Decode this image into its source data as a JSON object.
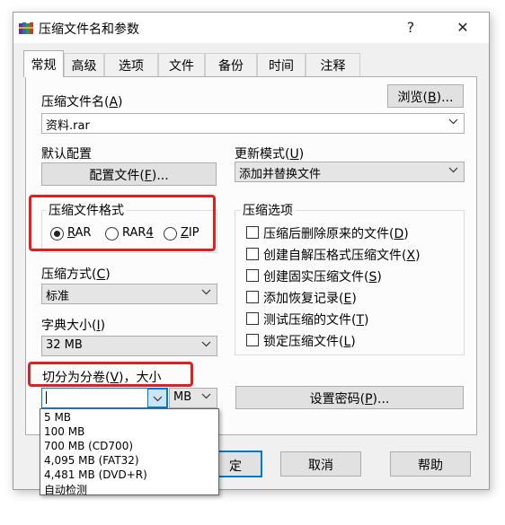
{
  "window": {
    "title": "压缩文件名和参数",
    "help_glyph": "?",
    "close_glyph": "✕",
    "icon": "winrar-books-icon"
  },
  "tabs": [
    {
      "label": "常规",
      "active": true
    },
    {
      "label": "高级"
    },
    {
      "label": "选项"
    },
    {
      "label": "文件"
    },
    {
      "label": "备份"
    },
    {
      "label": "时间"
    },
    {
      "label": "注释"
    }
  ],
  "archive_name": {
    "label": "压缩文件名(",
    "accel": "A",
    "label_end": ")",
    "value": "资料.rar",
    "browse_label": "浏览(",
    "browse_accel": "B",
    "browse_end": ")..."
  },
  "default_profile": {
    "label": "默认配置",
    "button_label": "配置文件(",
    "button_accel": "F",
    "button_end": ")..."
  },
  "update_mode": {
    "label": "更新模式(",
    "accel": "U",
    "label_end": ")",
    "value": "添加并替换文件"
  },
  "archive_format": {
    "title": "压缩文件格式",
    "options": [
      {
        "label": "RAR",
        "accel": "R",
        "rest": "AR",
        "selected": true
      },
      {
        "label": "RAR4",
        "pre": "RAR",
        "accel": "4",
        "selected": false
      },
      {
        "label": "ZIP",
        "accel": "Z",
        "rest": "IP",
        "selected": false
      }
    ]
  },
  "compression_method": {
    "label": "压缩方式(",
    "accel": "C",
    "label_end": ")",
    "value": "标准"
  },
  "dictionary_size": {
    "label": "字典大小(",
    "accel": "I",
    "label_end": ")",
    "value": "32 MB"
  },
  "split_volumes": {
    "label": "切分为分卷(",
    "accel": "V",
    "label_end": ")，大小",
    "value": "",
    "unit": "MB",
    "dropdown_items": [
      "5 MB",
      "100 MB",
      "700 MB  (CD700)",
      "4,095 MB  (FAT32)",
      "4,481 MB  (DVD+R)",
      "自动检测"
    ]
  },
  "archive_options": {
    "title": "压缩选项",
    "items": [
      {
        "label": "压缩后删除原来的文件(",
        "accel": "D",
        "end": ")",
        "checked": false
      },
      {
        "label": "创建自解压格式压缩文件(",
        "accel": "X",
        "end": ")",
        "checked": false
      },
      {
        "label": "创建固实压缩文件(",
        "accel": "S",
        "end": ")",
        "checked": false
      },
      {
        "label": "添加恢复记录(",
        "accel": "E",
        "end": ")",
        "checked": false
      },
      {
        "label": "测试压缩的文件(",
        "accel": "T",
        "end": ")",
        "checked": false
      },
      {
        "label": "锁定压缩文件(",
        "accel": "L",
        "end": ")",
        "checked": false
      }
    ]
  },
  "set_password": {
    "label": "设置密码(",
    "accel": "P",
    "end": ")..."
  },
  "footer": {
    "ok_partial": "定",
    "cancel_label": "取消",
    "help_label": "帮助"
  },
  "colors": {
    "highlight": "#e02020",
    "focus": "#0078d7"
  }
}
